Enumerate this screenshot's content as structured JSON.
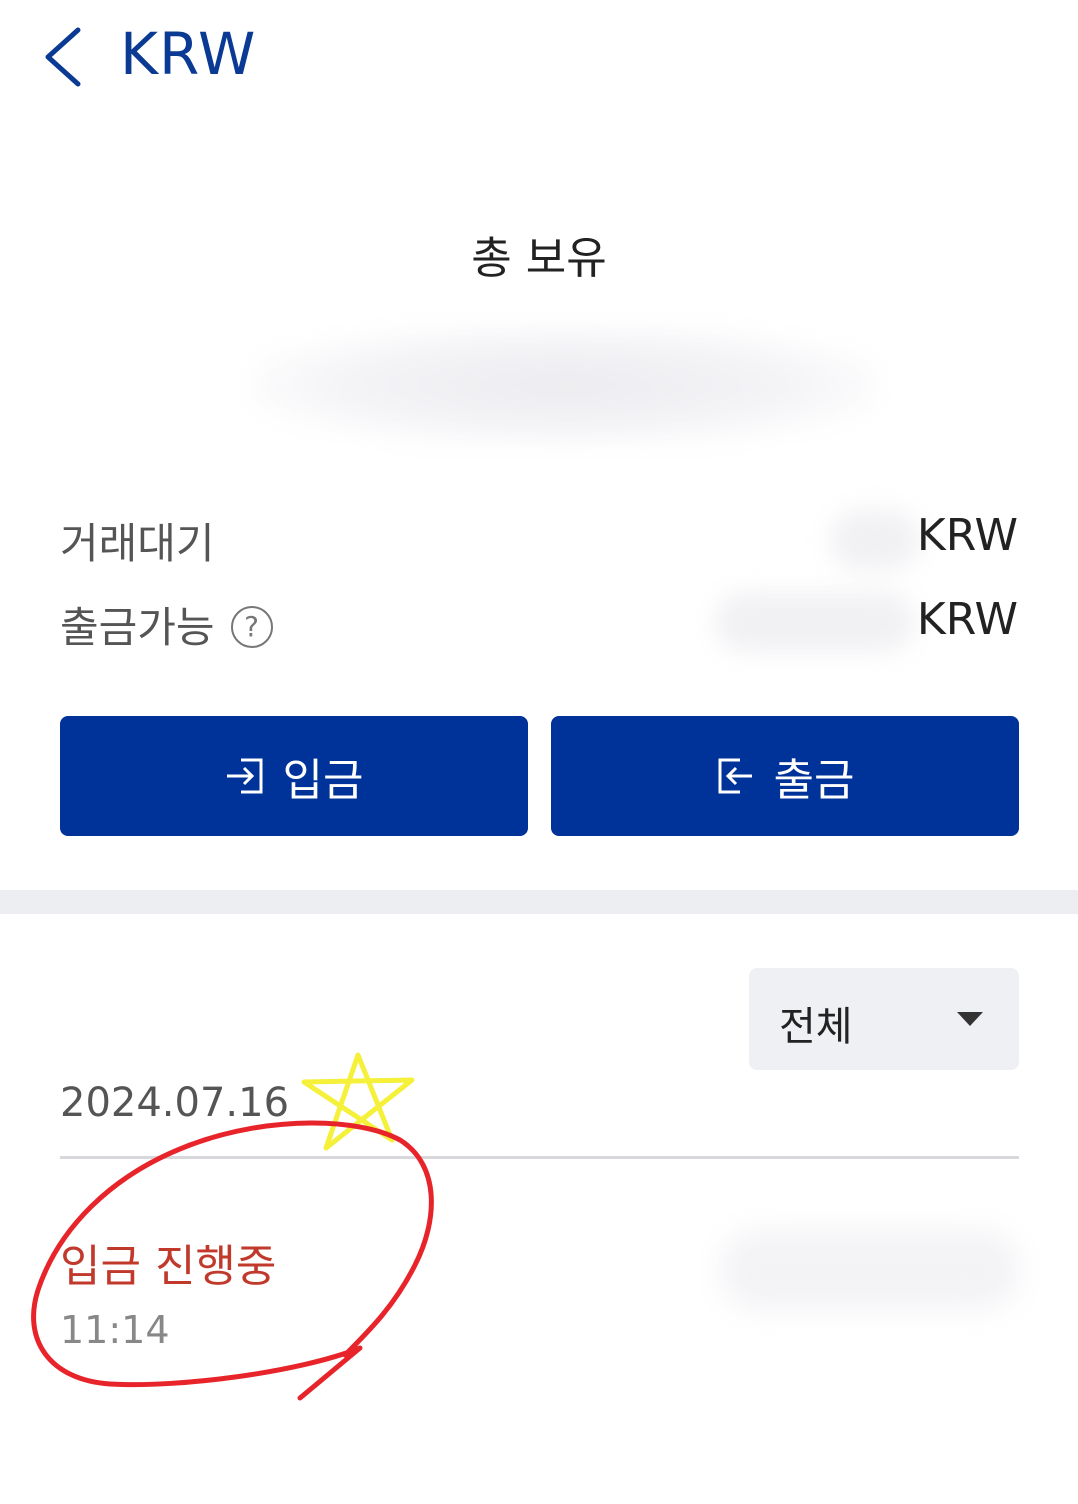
{
  "header": {
    "title": "KRW"
  },
  "summary": {
    "total_label": "총 보유"
  },
  "balances": [
    {
      "label": "거래대기",
      "unit": "KRW"
    },
    {
      "label": "출금가능",
      "unit": "KRW",
      "help_symbol": "?"
    }
  ],
  "actions": {
    "deposit_label": "입금",
    "withdraw_label": "출금"
  },
  "filter": {
    "selected": "전체"
  },
  "history": {
    "date": "2024.07.16",
    "items": [
      {
        "status": "입금 진행중",
        "time": "11:14"
      }
    ]
  },
  "colors": {
    "brand": "#003399",
    "title": "#0a3a94",
    "pending_status": "#c0392b",
    "annotation_circle": "#e8242b",
    "annotation_star": "#f5f03a"
  }
}
